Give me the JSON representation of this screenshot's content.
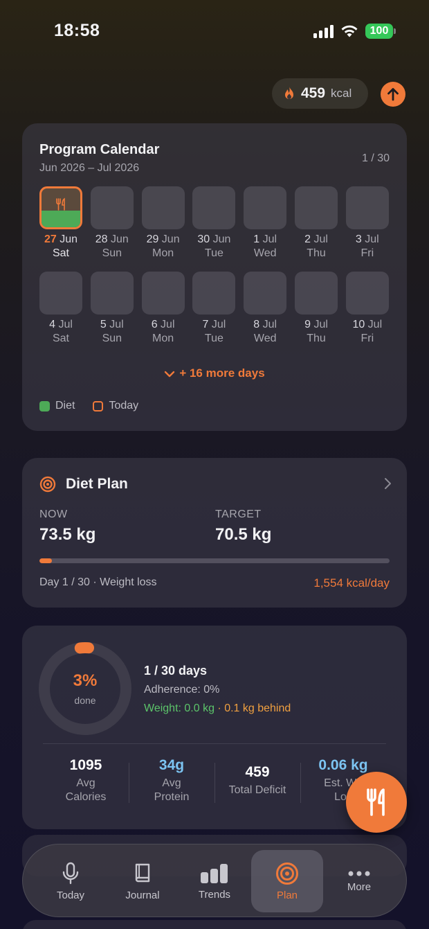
{
  "status": {
    "time": "18:58",
    "battery": "100"
  },
  "header": {
    "kcal_value": "459",
    "kcal_unit": "kcal"
  },
  "calendar": {
    "title": "Program Calendar",
    "range": "Jun 2026 – Jul 2026",
    "count": "1 / 30",
    "days": [
      {
        "num": "27",
        "mon": "Jun",
        "wd": "Sat",
        "today": true,
        "diet": true
      },
      {
        "num": "28",
        "mon": "Jun",
        "wd": "Sun"
      },
      {
        "num": "29",
        "mon": "Jun",
        "wd": "Mon"
      },
      {
        "num": "30",
        "mon": "Jun",
        "wd": "Tue"
      },
      {
        "num": "1",
        "mon": "Jul",
        "wd": "Wed"
      },
      {
        "num": "2",
        "mon": "Jul",
        "wd": "Thu"
      },
      {
        "num": "3",
        "mon": "Jul",
        "wd": "Fri"
      },
      {
        "num": "4",
        "mon": "Jul",
        "wd": "Sat"
      },
      {
        "num": "5",
        "mon": "Jul",
        "wd": "Sun"
      },
      {
        "num": "6",
        "mon": "Jul",
        "wd": "Mon"
      },
      {
        "num": "7",
        "mon": "Jul",
        "wd": "Tue"
      },
      {
        "num": "8",
        "mon": "Jul",
        "wd": "Wed"
      },
      {
        "num": "9",
        "mon": "Jul",
        "wd": "Thu"
      },
      {
        "num": "10",
        "mon": "Jul",
        "wd": "Fri"
      }
    ],
    "more_label": "+ 16 more days",
    "legend_diet": "Diet",
    "legend_today": "Today"
  },
  "plan": {
    "title": "Diet Plan",
    "now_label": "NOW",
    "now_value": "73.5 kg",
    "target_label": "TARGET",
    "target_value": "70.5 kg",
    "progress": 0.035,
    "footer": "Day 1 / 30 · Weight loss",
    "kcal_per_day": "1,554 kcal/day"
  },
  "progress": {
    "percent_label": "3%",
    "done_label": "done",
    "fraction": 0.033,
    "days": "1 / 30 days",
    "adherence": "Adherence: 0%",
    "weight": "Weight: 0.0 kg",
    "sep": " · ",
    "behind": "0.1 kg behind",
    "stats": [
      {
        "value": "1095",
        "label1": "Avg",
        "label2": "Calories",
        "color": "#ffffff"
      },
      {
        "value": "34g",
        "label1": "Avg",
        "label2": "Protein",
        "color": "#7cc4f2"
      },
      {
        "value": "459",
        "label1": "Total Deficit",
        "label2": "",
        "color": "#ffffff"
      },
      {
        "value": "0.06 kg",
        "label1": "Est. We",
        "label2": "Los",
        "color": "#7cc4f2"
      }
    ]
  },
  "tabs": [
    {
      "label": "Today",
      "icon": "mic-icon"
    },
    {
      "label": "Journal",
      "icon": "book-icon"
    },
    {
      "label": "Trends",
      "icon": "bars-icon"
    },
    {
      "label": "Plan",
      "icon": "target-icon",
      "active": true
    },
    {
      "label": "More",
      "icon": "dots-icon"
    }
  ],
  "colors": {
    "accent": "#f07a3a",
    "diet": "#4daa57",
    "blue": "#7cc4f2"
  }
}
